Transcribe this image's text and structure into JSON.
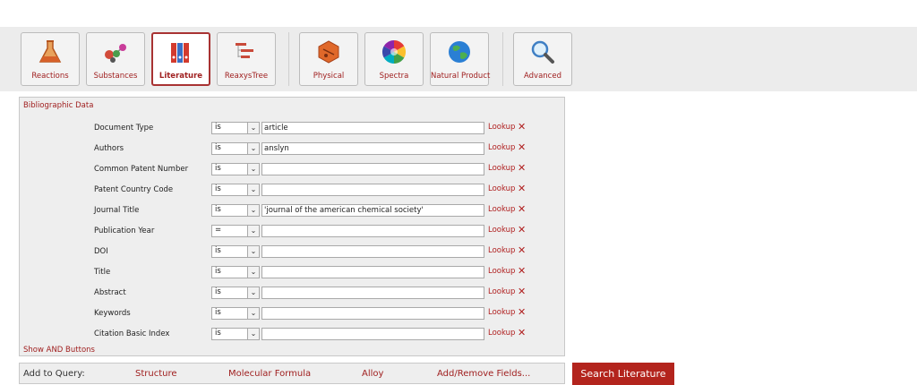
{
  "toolbar": {
    "tools": [
      {
        "label": "Reactions",
        "icon": "flask-icon"
      },
      {
        "label": "Substances",
        "icon": "molecules-icon"
      },
      {
        "label": "Literature",
        "icon": "binders-icon",
        "active": true
      },
      {
        "label": "ReaxysTree",
        "icon": "tree-icon"
      },
      {
        "label": "Physical",
        "icon": "hexagon-icon"
      },
      {
        "label": "Spectra",
        "icon": "color-wheel-icon"
      },
      {
        "label": "Natural Product",
        "icon": "globe-icon"
      },
      {
        "label": "Advanced",
        "icon": "magnifier-icon"
      }
    ]
  },
  "form": {
    "section_title": "Bibliographic Data",
    "lookup_label": "Lookup",
    "remove_label": "✕",
    "fields": [
      {
        "label": "Document Type",
        "operator": "is",
        "value": "article"
      },
      {
        "label": "Authors",
        "operator": "is",
        "value": "anslyn"
      },
      {
        "label": "Common Patent Number",
        "operator": "is",
        "value": ""
      },
      {
        "label": "Patent Country Code",
        "operator": "is",
        "value": ""
      },
      {
        "label": "Journal Title",
        "operator": "is",
        "value": "'journal of the american chemical society'"
      },
      {
        "label": "Publication Year",
        "operator": "=",
        "value": ""
      },
      {
        "label": "DOI",
        "operator": "is",
        "value": ""
      },
      {
        "label": "Title",
        "operator": "is",
        "value": ""
      },
      {
        "label": "Abstract",
        "operator": "is",
        "value": ""
      },
      {
        "label": "Keywords",
        "operator": "is",
        "value": ""
      },
      {
        "label": "Citation Basic Index",
        "operator": "is",
        "value": ""
      }
    ],
    "show_and_buttons": "Show AND Buttons"
  },
  "add_to_query": {
    "label": "Add to Query:",
    "links": [
      "Structure",
      "Molecular Formula",
      "Alloy",
      "Add/Remove Fields..."
    ]
  },
  "search_button": "Search Literature",
  "colors": {
    "accent": "#b3241d",
    "link": "#a02020",
    "panel": "#eeeeee",
    "toolbar": "#ececec"
  }
}
